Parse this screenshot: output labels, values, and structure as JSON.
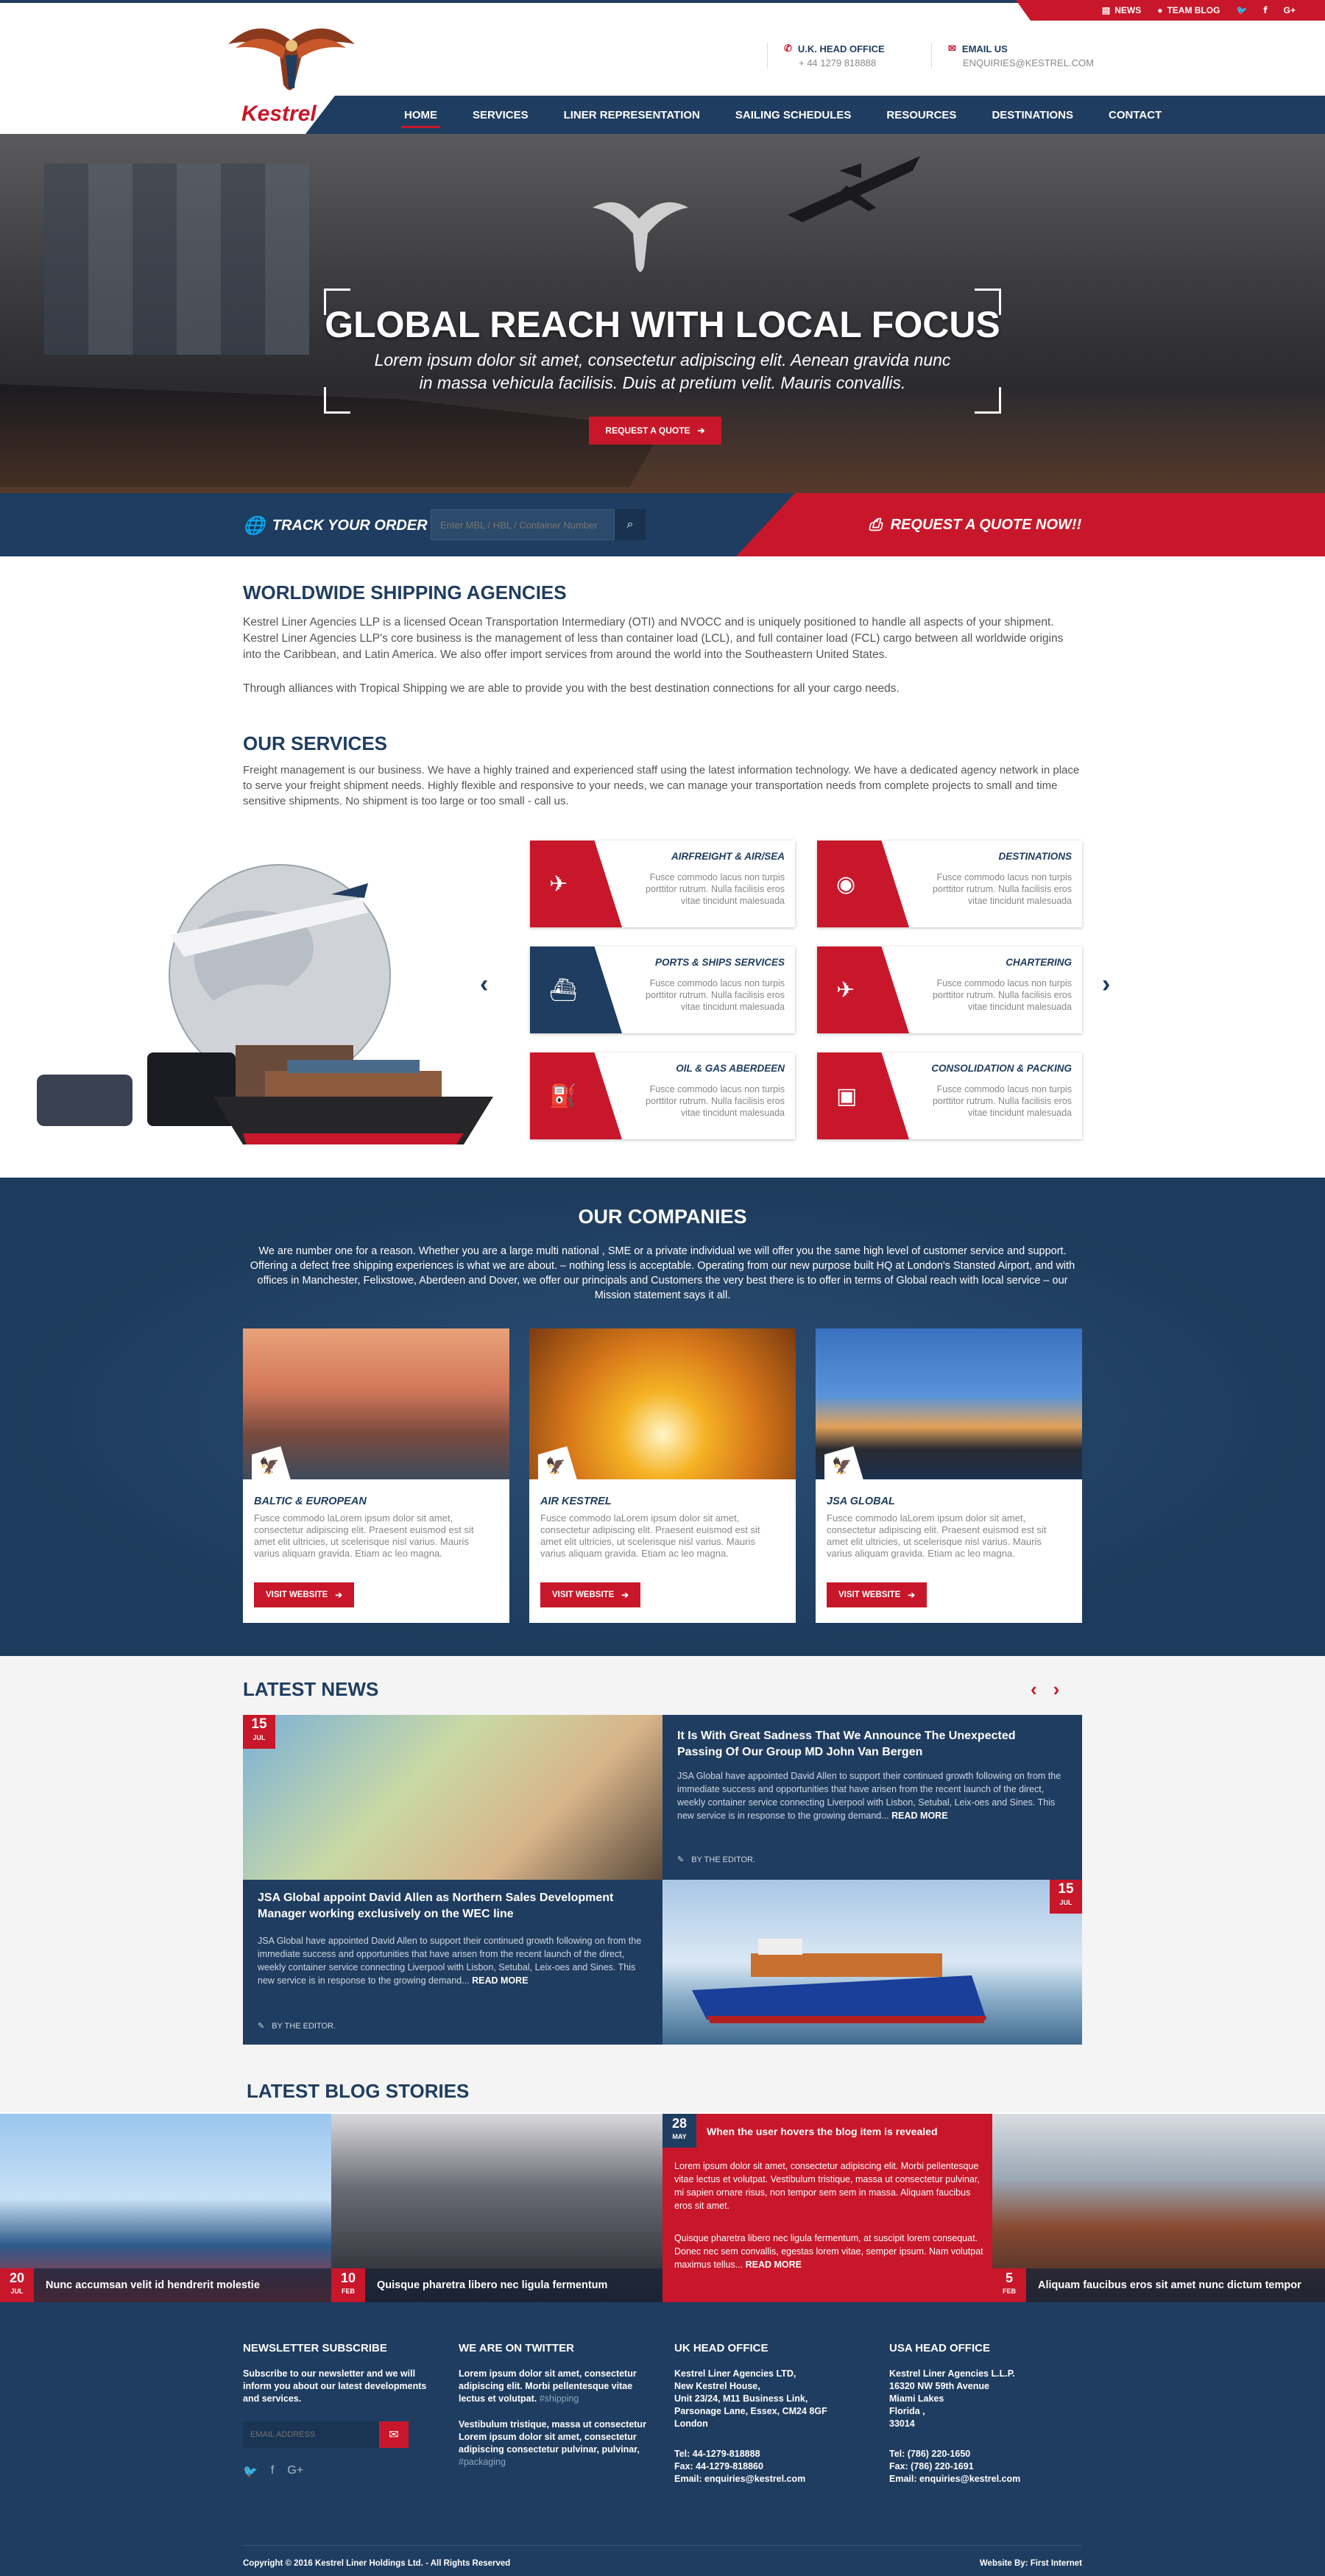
{
  "topbar": {
    "news": "NEWS",
    "team_blog": "TEAM BLOG"
  },
  "logo": {
    "brand": "Kestrel"
  },
  "contact": {
    "office_label": "U.K. HEAD OFFICE",
    "office_value": "+ 44 1279 818888",
    "email_label": "EMAIL US",
    "email_value": "ENQUIRIES@KESTREL.COM"
  },
  "nav": {
    "items": [
      "HOME",
      "SERVICES",
      "LINER REPRESENTATION",
      "SAILING SCHEDULES",
      "RESOURCES",
      "DESTINATIONS",
      "CONTACT"
    ]
  },
  "hero": {
    "title": "GLOBAL REACH WITH LOCAL FOCUS",
    "subtitle": "Lorem ipsum dolor sit amet, consectetur adipiscing elit. Aenean gravida nunc in massa vehicula facilisis. Duis at pretium velit. Mauris convallis.",
    "button": "REQUEST A QUOTE"
  },
  "track": {
    "label": "TRACK YOUR ORDER",
    "placeholder": "Enter MBL / HBL / Container Number",
    "quote": "REQUEST A QUOTE NOW!!"
  },
  "about": {
    "title": "WORLDWIDE SHIPPING AGENCIES",
    "p1": "Kestrel Liner Agencies LLP is a licensed Ocean Transportation Intermediary (OTI) and NVOCC and is uniquely positioned to handle all aspects of your shipment. Kestrel Liner Agencies LLP's core business is the management of less than container load (LCL), and full container load (FCL) cargo between all worldwide origins into the Caribbean, and Latin America. We also offer import services from around the world into the Southeastern United States.",
    "p2": "Through alliances with Tropical Shipping we are able to provide you with the best destination connections for all your cargo needs."
  },
  "services": {
    "title": "OUR SERVICES",
    "intro": "Freight management is our business. We have a highly trained and experienced staff using the latest information technology. We have a dedicated agency network in place to serve your freight shipment needs. Highly flexible and responsive to your needs, we can manage your transportation needs from complete projects to small and time sensitive shipments. No shipment is too large or too small - call us.",
    "desc": "Fusce commodo lacus non turpis porttitor rutrum. Nulla facilisis eros vitae tincidunt malesuada",
    "cards": [
      "AIRFREIGHT & AIR/SEA",
      "DESTINATIONS",
      "PORTS & SHIPS SERVICES",
      "CHARTERING",
      "OIL & GAS ABERDEEN",
      "CONSOLIDATION & PACKING"
    ]
  },
  "companies": {
    "title": "OUR COMPANIES",
    "intro": "We are number one for a reason. Whether you are a large multi national , SME or a private individual we will offer you the same high level of customer service and support. Offering a defect free shipping experiences is what we are about. – nothing less is acceptable.  Operating from our new purpose built HQ at London's Stansted Airport, and with offices in Manchester, Felixstowe, Aberdeen and Dover, we offer our principals and Customers the very best there is to offer in terms of Global reach with local service – our Mission statement says it all.",
    "desc": "Fusce commodo laLorem ipsum dolor sit amet, consectetur adipiscing elit. Praesent euismod est sit amet elit ultricies, ut scelerisque nisl varius. Mauris varius aliquam gravida. Etiam ac leo magna.",
    "button": "VISIT WEBSITE",
    "items": [
      "BALTIC & EUROPEAN",
      "AIR KESTREL",
      "JSA GLOBAL"
    ]
  },
  "news": {
    "title": "LATEST NEWS",
    "item1": {
      "day": "15",
      "month": "JUL",
      "title": "It Is With Great Sadness That We Announce The Unexpected Passing Of Our Group MD John Van Bergen",
      "text": "JSA Global have appointed David Allen to support their continued growth following on from the immediate success and opportunities that have arisen from the recent launch of the direct, weekly container service connecting Liverpool with Lisbon, Setubal, Leix-oes and Sines.  This new service is in response to the growing demand...",
      "more": "READ MORE",
      "by": "BY THE EDITOR."
    },
    "item2": {
      "day": "15",
      "month": "JUL",
      "title": "JSA Global appoint David Allen as Northern Sales Development Manager working exclusively on the WEC line",
      "text": "JSA Global have appointed David Allen to support their continued growth following on from the immediate success and opportunities that have arisen from the recent launch of the direct, weekly container service connecting Liverpool with Lisbon, Setubal, Leix-oes and Sines.  This new service is in response to the growing demand...",
      "more": "READ MORE",
      "by": "BY THE EDITOR."
    }
  },
  "blog": {
    "title": "LATEST BLOG STORIES",
    "cards": [
      {
        "day": "20",
        "month": "JUL",
        "caption": "Nunc accumsan velit id hendrerit molestie"
      },
      {
        "day": "10",
        "month": "FEB",
        "caption": "Quisque pharetra libero nec ligula fermentum"
      },
      {
        "day": "5",
        "month": "FEB",
        "caption": "Aliquam faucibus eros sit amet nunc dictum tempor"
      }
    ],
    "featured": {
      "day": "28",
      "month": "MAY",
      "title": "When the user hovers the blog item is revealed",
      "p1": "Lorem ipsum dolor sit amet, consectetur adipiscing elit. Morbi pellentesque vitae lectus et volutpat. Vestibulum tristique, massa ut consectetur pulvinar, mi sapien ornare risus, non tempor sem sem in massa. Aliquam faucibus eros sit amet.",
      "p2": "Quisque pharetra libero nec ligula fermentum, at suscipit lorem consequat. Donec nec sem convallis, egestas lorem vitae, semper ipsum. Nam volutpat maximus tellus...",
      "more": "READ MORE"
    }
  },
  "footer": {
    "newsletter": {
      "title": "NEWSLETTER SUBSCRIBE",
      "text": "Subscribe to our newsletter and we will inform you about our latest developments and services.",
      "placeholder": "EMAIL ADDRESS"
    },
    "twitter": {
      "title": "WE ARE ON TWITTER",
      "t1": "Lorem ipsum dolor sit amet, consectetur adipiscing elit. Morbi pellentesque vitae lectus et volutpat.",
      "tag1": "#shipping",
      "t2": "Vestibulum tristique, massa ut consectetur Lorem ipsum dolor sit amet, consectetur adipiscing consectetur pulvinar, pulvinar,",
      "tag2": "#packaging"
    },
    "uk": {
      "title": "UK HEAD OFFICE",
      "lines": [
        "Kestrel Liner Agencies LTD,",
        "New Kestrel House,",
        "Unit 23/24, M11 Business Link,",
        "Parsonage Lane, Essex, CM24 8GF",
        "London"
      ],
      "tel": "Tel: 44-1279-818888",
      "fax": "Fax: 44-1279-818860",
      "email": "Email:  enquiries@kestrel.com"
    },
    "usa": {
      "title": "USA HEAD OFFICE",
      "lines": [
        "Kestrel Liner Agencies L.L.P.",
        "16320 NW 59th Avenue",
        "Miami Lakes",
        "Florida ,",
        "33014"
      ],
      "tel": "Tel: (786) 220-1650",
      "fax": "Fax: (786) 220-1691",
      "email": "Email:  enquiries@kestrel.com"
    },
    "copyright": "Copyright © 2016 Kestrel Liner Holdings Ltd. - All Rights Reserved",
    "credit": "Website By: First Internet"
  }
}
